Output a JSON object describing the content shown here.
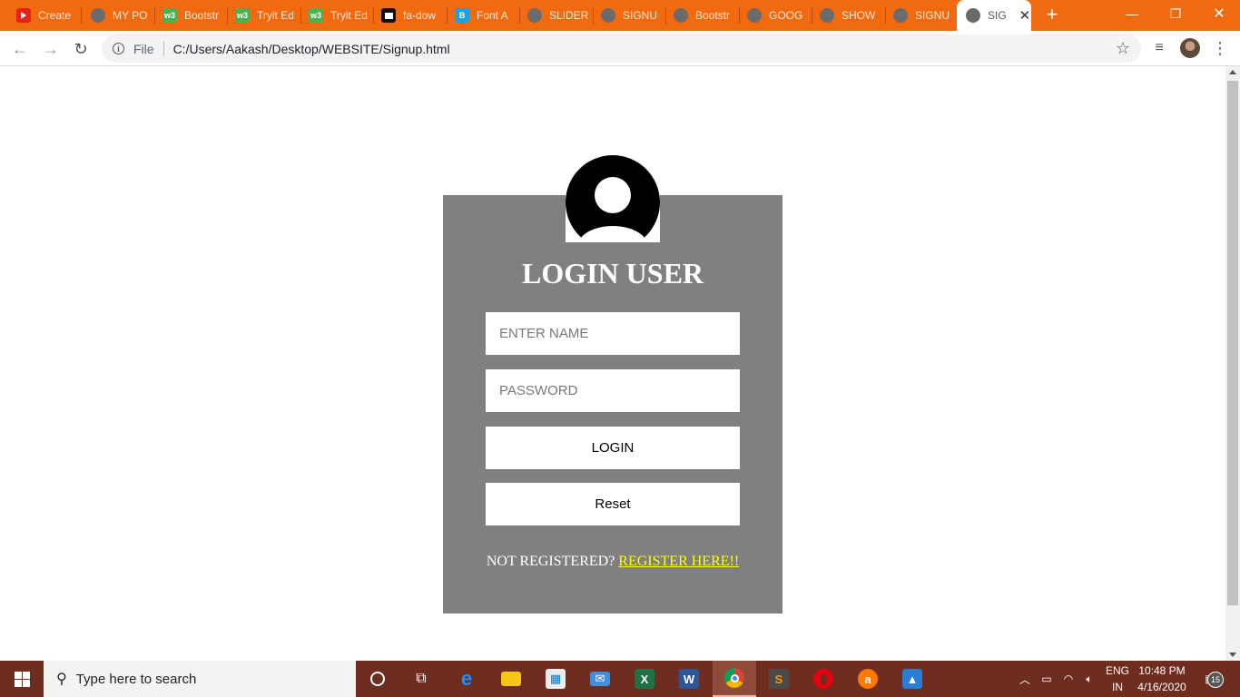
{
  "browser": {
    "tabs": [
      {
        "label": "Create",
        "icon": "youtube-icon"
      },
      {
        "label": "MY PO",
        "icon": "globe-icon"
      },
      {
        "label": "Bootstr",
        "icon": "w3schools-icon"
      },
      {
        "label": "Tryit Ed",
        "icon": "w3schools-icon"
      },
      {
        "label": "Tryit Ed",
        "icon": "w3schools-icon"
      },
      {
        "label": "fa-dow",
        "icon": "flag-icon"
      },
      {
        "label": "Font A",
        "icon": "bootstrap-icon"
      },
      {
        "label": "SLIDER",
        "icon": "globe-icon"
      },
      {
        "label": "SIGNU",
        "icon": "globe-icon"
      },
      {
        "label": "Bootstr",
        "icon": "globe-icon"
      },
      {
        "label": "GOOG",
        "icon": "globe-icon"
      },
      {
        "label": "SHOW",
        "icon": "globe-icon"
      },
      {
        "label": "SIGNU",
        "icon": "globe-icon"
      },
      {
        "label": "SIG",
        "icon": "globe-icon",
        "active": true
      }
    ],
    "new_tab": "+",
    "address": {
      "scheme_label": "File",
      "url": "C:/Users/Aakash/Desktop/WEBSITE/Signup.html"
    },
    "theme_color": "#f26a10"
  },
  "page": {
    "title": "LOGIN USER",
    "name_placeholder": "ENTER NAME",
    "password_placeholder": "PASSWORD",
    "login_label": "LOGIN",
    "reset_label": "Reset",
    "register_prompt": "NOT REGISTERED?",
    "register_link": "REGISTER HERE!!",
    "box_color": "#808080",
    "link_color": "#ffff00"
  },
  "taskbar": {
    "search_placeholder": "Type here to search",
    "apps": [
      "cortana-icon",
      "task-view-icon",
      "edge-icon",
      "file-explorer-icon",
      "store-icon",
      "mail-icon",
      "excel-icon",
      "word-icon",
      "chrome-icon",
      "sublime-icon",
      "opera-icon",
      "avast-icon",
      "photos-icon"
    ],
    "language": "ENG",
    "region": "IN",
    "time": "10:48 PM",
    "date": "4/16/2020",
    "notifications": "15",
    "color": "#6e2d1f"
  }
}
